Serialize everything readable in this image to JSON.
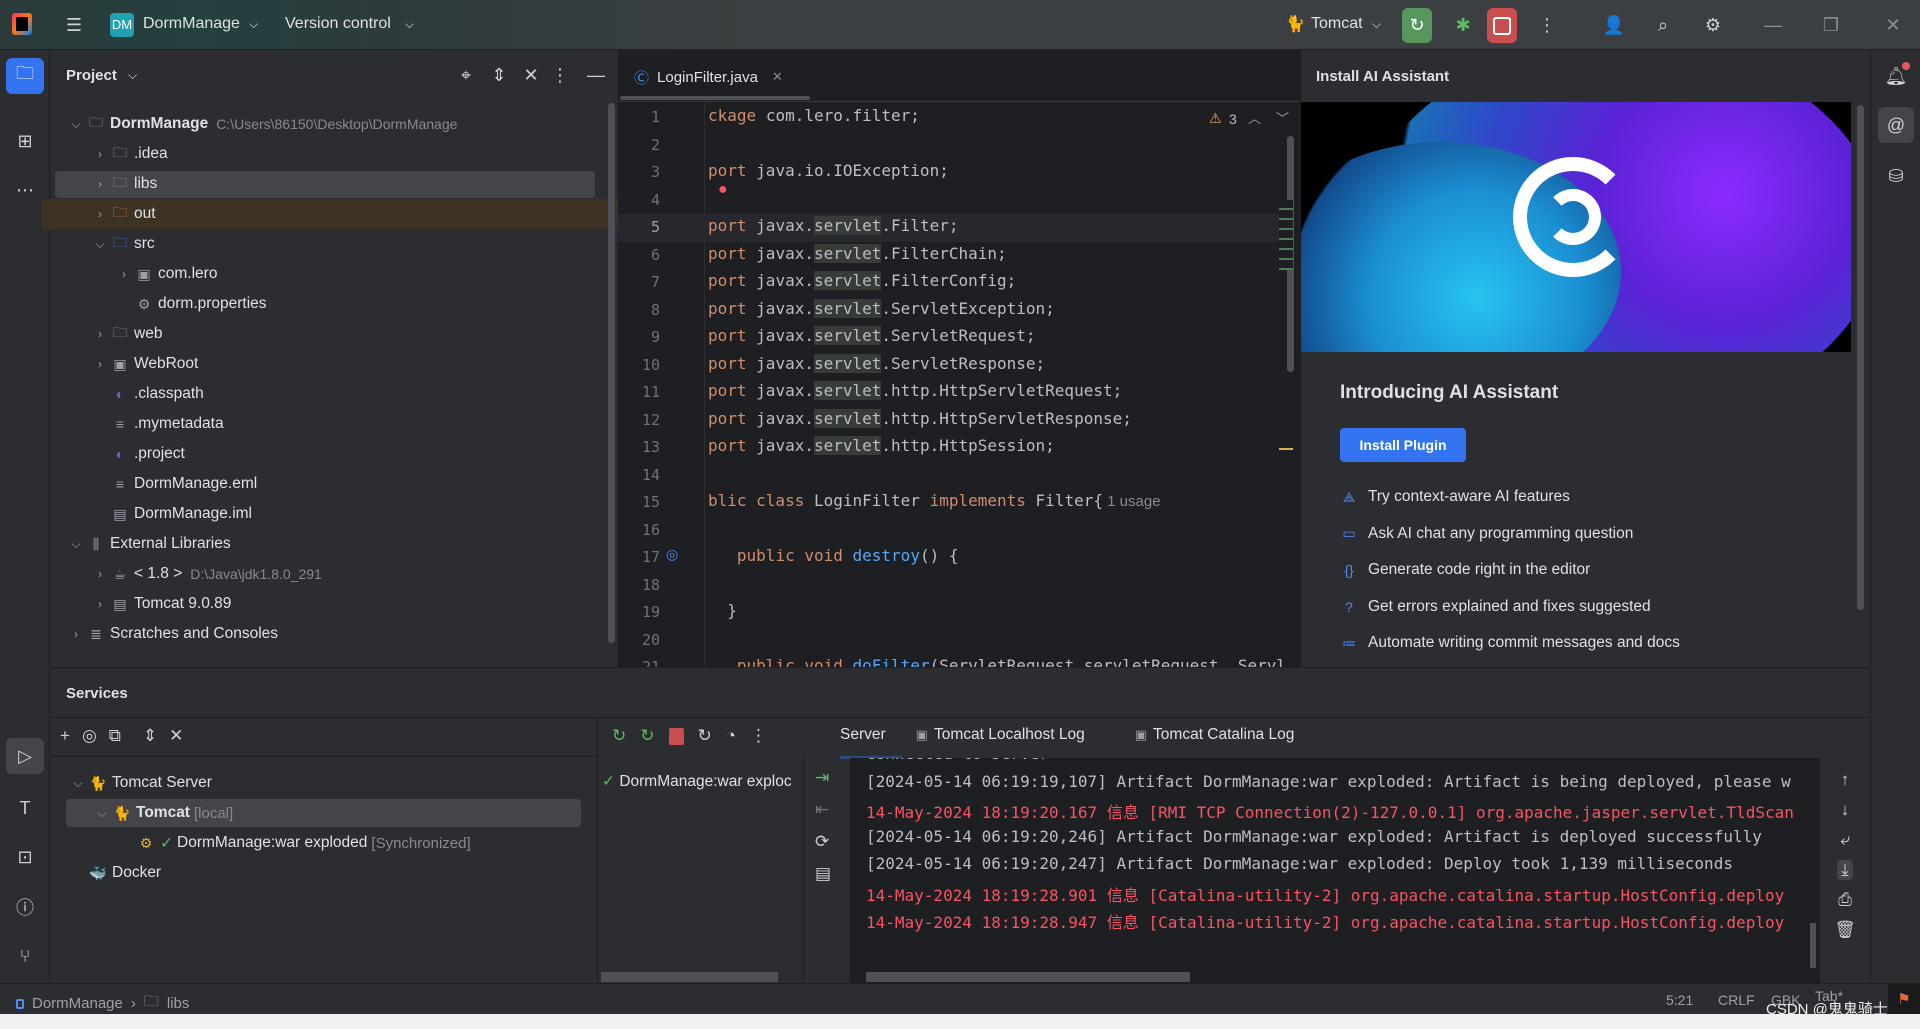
{
  "topbar": {
    "project_badge": "DM",
    "project_name": "DormManage",
    "vcs": "Version control",
    "run_config": "Tomcat"
  },
  "project_panel": {
    "title": "Project",
    "tree": [
      {
        "label": "DormManage",
        "extra": "C:\\Users\\86150\\Desktop\\DormManage",
        "depth": 0,
        "arrow": "v",
        "icon": "module-folder-icon",
        "bold": true
      },
      {
        "label": ".idea",
        "depth": 1,
        "arrow": ">",
        "icon": "folder-icon"
      },
      {
        "label": "libs",
        "depth": 1,
        "arrow": ">",
        "icon": "folder-icon",
        "selected": true
      },
      {
        "label": "out",
        "depth": 1,
        "arrow": ">",
        "icon": "excluded-folder-icon",
        "excluded": true
      },
      {
        "label": "src",
        "depth": 1,
        "arrow": "v",
        "icon": "source-folder-icon"
      },
      {
        "label": "com.lero",
        "depth": 2,
        "arrow": ">",
        "icon": "package-icon"
      },
      {
        "label": "dorm.properties",
        "depth": 2,
        "arrow": "",
        "icon": "properties-file-icon"
      },
      {
        "label": "web",
        "depth": 1,
        "arrow": ">",
        "icon": "folder-icon"
      },
      {
        "label": "WebRoot",
        "depth": 1,
        "arrow": ">",
        "icon": "web-folder-icon"
      },
      {
        "label": ".classpath",
        "depth": 1,
        "arrow": "",
        "icon": "eclipse-file-icon"
      },
      {
        "label": ".mymetadata",
        "depth": 1,
        "arrow": "",
        "icon": "text-file-icon"
      },
      {
        "label": ".project",
        "depth": 1,
        "arrow": "",
        "icon": "eclipse-file-icon"
      },
      {
        "label": "DormManage.eml",
        "depth": 1,
        "arrow": "",
        "icon": "text-file-icon"
      },
      {
        "label": "DormManage.iml",
        "depth": 1,
        "arrow": "",
        "icon": "iml-file-icon"
      },
      {
        "label": "External Libraries",
        "depth": 0,
        "arrow": "v",
        "icon": "libraries-icon"
      },
      {
        "label": "< 1.8 >",
        "extra": "D:\\Java\\jdk1.8.0_291",
        "depth": 1,
        "arrow": ">",
        "icon": "jdk-icon"
      },
      {
        "label": "Tomcat 9.0.89",
        "depth": 1,
        "arrow": ">",
        "icon": "library-icon"
      },
      {
        "label": "Scratches and Consoles",
        "depth": 0,
        "arrow": ">",
        "icon": "scratches-icon"
      }
    ]
  },
  "editor": {
    "tab": "LoginFilter.java",
    "warnings": "3",
    "lines": [
      [
        [
          "kw",
          "ckage"
        ],
        [
          "",
          "com.lero.filter;"
        ]
      ],
      [],
      [
        [
          "kw",
          "port"
        ],
        [
          "",
          "java.io.IOException;"
        ]
      ],
      [],
      [
        [
          "kw",
          "port"
        ],
        [
          "",
          "javax."
        ],
        [
          "hl",
          "servlet"
        ],
        [
          "",
          ".Filter;"
        ]
      ],
      [
        [
          "kw",
          "port"
        ],
        [
          "",
          "javax."
        ],
        [
          "hl",
          "servlet"
        ],
        [
          "",
          ".FilterChain;"
        ]
      ],
      [
        [
          "kw",
          "port"
        ],
        [
          "",
          "javax."
        ],
        [
          "hl",
          "servlet"
        ],
        [
          "",
          ".FilterConfig;"
        ]
      ],
      [
        [
          "kw",
          "port"
        ],
        [
          "",
          "javax."
        ],
        [
          "hl",
          "servlet"
        ],
        [
          "",
          ".ServletException;"
        ]
      ],
      [
        [
          "kw",
          "port"
        ],
        [
          "",
          "javax."
        ],
        [
          "hl",
          "servlet"
        ],
        [
          "",
          ".ServletRequest;"
        ]
      ],
      [
        [
          "kw",
          "port"
        ],
        [
          "",
          "javax."
        ],
        [
          "hl",
          "servlet"
        ],
        [
          "",
          ".ServletResponse;"
        ]
      ],
      [
        [
          "kw",
          "port"
        ],
        [
          "",
          "javax."
        ],
        [
          "hl",
          "servlet"
        ],
        [
          "",
          ".http.HttpServletRequest;"
        ]
      ],
      [
        [
          "kw",
          "port"
        ],
        [
          "",
          "javax."
        ],
        [
          "hl",
          "servlet"
        ],
        [
          "",
          ".http.HttpServletResponse;"
        ]
      ],
      [
        [
          "kw",
          "port"
        ],
        [
          "",
          "javax."
        ],
        [
          "hl",
          "servlet"
        ],
        [
          "",
          ".http.HttpSession;"
        ]
      ],
      [],
      [
        [
          "kw",
          "blic class"
        ],
        [
          "",
          "LoginFilter"
        ],
        [
          "kw",
          "implements"
        ],
        [
          "",
          "Filter{"
        ],
        [
          "hint",
          " 1 usage"
        ]
      ],
      [],
      [
        [
          "",
          "  "
        ],
        [
          "kw",
          "public void"
        ],
        [
          "fn",
          "destroy"
        ],
        [
          "",
          "() {"
        ]
      ],
      [],
      [
        [
          "",
          "  }"
        ]
      ],
      [],
      [
        [
          "",
          "  "
        ],
        [
          "kw",
          "public void"
        ],
        [
          "fn",
          "doFilter"
        ],
        [
          "",
          "(ServletRequest servletRequest, Servl"
        ]
      ]
    ]
  },
  "ai_panel": {
    "title": "Install AI Assistant",
    "heading": "Introducing AI Assistant",
    "install_button": "Install Plugin",
    "features": [
      {
        "icon": "ai-context-icon",
        "text": "Try context-aware AI features"
      },
      {
        "icon": "chat-icon",
        "text": "Ask AI chat any programming question"
      },
      {
        "icon": "code-braces-icon",
        "text": "Generate code right in the editor"
      },
      {
        "icon": "question-icon",
        "text": "Get errors explained and fixes suggested"
      },
      {
        "icon": "commit-list-icon",
        "text": "Automate writing commit messages and docs"
      }
    ]
  },
  "services": {
    "title": "Services",
    "tree": [
      {
        "label": "Tomcat Server",
        "depth": 0,
        "arrow": "v"
      },
      {
        "label": "Tomcat",
        "extra": "[local]",
        "depth": 1,
        "arrow": "v",
        "selected": true,
        "bold": true
      },
      {
        "label": "DormManage:war exploded",
        "extra": "[Synchronized]",
        "depth": 2,
        "arrow": ""
      },
      {
        "label": "Docker",
        "depth": 0,
        "arrow": ""
      }
    ],
    "deployment": "DormManage:war exploc",
    "tabs": [
      "Server",
      "Tomcat Localhost Log",
      "Tomcat Catalina Log"
    ],
    "log": [
      {
        "text": "Connected to server",
        "err": false
      },
      {
        "text": "[2024-05-14 06:19:19,107] Artifact DormManage:war exploded: Artifact is being deployed, please w",
        "err": false
      },
      {
        "text": "14-May-2024 18:19:20.167 信息 [RMI TCP Connection(2)-127.0.0.1] org.apache.jasper.servlet.TldScan",
        "err": true
      },
      {
        "text": "[2024-05-14 06:19:20,246] Artifact DormManage:war exploded: Artifact is deployed successfully",
        "err": false
      },
      {
        "text": "[2024-05-14 06:19:20,247] Artifact DormManage:war exploded: Deploy took 1,139 milliseconds",
        "err": false
      },
      {
        "text": "14-May-2024 18:19:28.901 信息 [Catalina-utility-2] org.apache.catalina.startup.HostConfig.deploy",
        "err": true
      },
      {
        "text": "14-May-2024 18:19:28.947 信息 [Catalina-utility-2] org.apache.catalina.startup.HostConfig.deploy",
        "err": true
      }
    ]
  },
  "statusbar": {
    "crumbs": [
      "DormManage",
      "libs"
    ],
    "position": "5:21",
    "line_sep": "CRLF",
    "encoding": "GBK",
    "indent": "Tab*",
    "watermark": "CSDN @鬼鬼骑士"
  },
  "colors": {
    "accent": "#3574f0",
    "run": "#57965c",
    "stop": "#c94f4f",
    "error": "#f75464",
    "keyword": "#cf8e6d"
  }
}
